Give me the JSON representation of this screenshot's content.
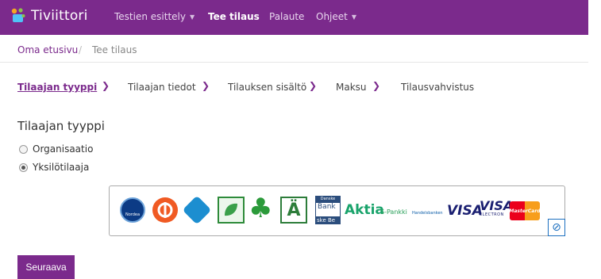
{
  "navbar": {
    "brand": "Tiviittori",
    "items": [
      {
        "label": "Testien esittely",
        "dropdown": true
      },
      {
        "label": "Tee tilaus",
        "active": true
      },
      {
        "label": "Palaute"
      },
      {
        "label": "Ohjeet",
        "dropdown": true
      }
    ]
  },
  "breadcrumb": {
    "home": "Oma etusivu",
    "separator": "/",
    "current": "Tee tilaus"
  },
  "steps": [
    {
      "label": "Tilaajan tyyppi",
      "current": true
    },
    {
      "label": "Tilaajan tiedot"
    },
    {
      "label": "Tilauksen sisältö"
    },
    {
      "label": "Maksu"
    },
    {
      "label": "Tilausvahvistus"
    }
  ],
  "step_arrow": "❯",
  "section_title": "Tilaajan tyyppi",
  "options": [
    {
      "label": "Organisaatio",
      "checked": false
    },
    {
      "label": "Yksilötilaaja",
      "checked": true
    }
  ],
  "banks": {
    "nordea": "Nordea",
    "danske_top": "Danske",
    "danske_mid": "Bank",
    "danske_bot": "ske Be",
    "aktia": "Aktia",
    "spankki": "S-Pankki",
    "handelsbanken": "Handelsbanken",
    "visa": "VISA",
    "visa_electron_top": "VISA",
    "visa_electron_bottom": "ELECTRON",
    "mastercard": "MasterCard"
  },
  "next_button": "Seuraava",
  "colors": {
    "brand": "#7b2a8c",
    "nav_text": "#e8d6ee"
  }
}
